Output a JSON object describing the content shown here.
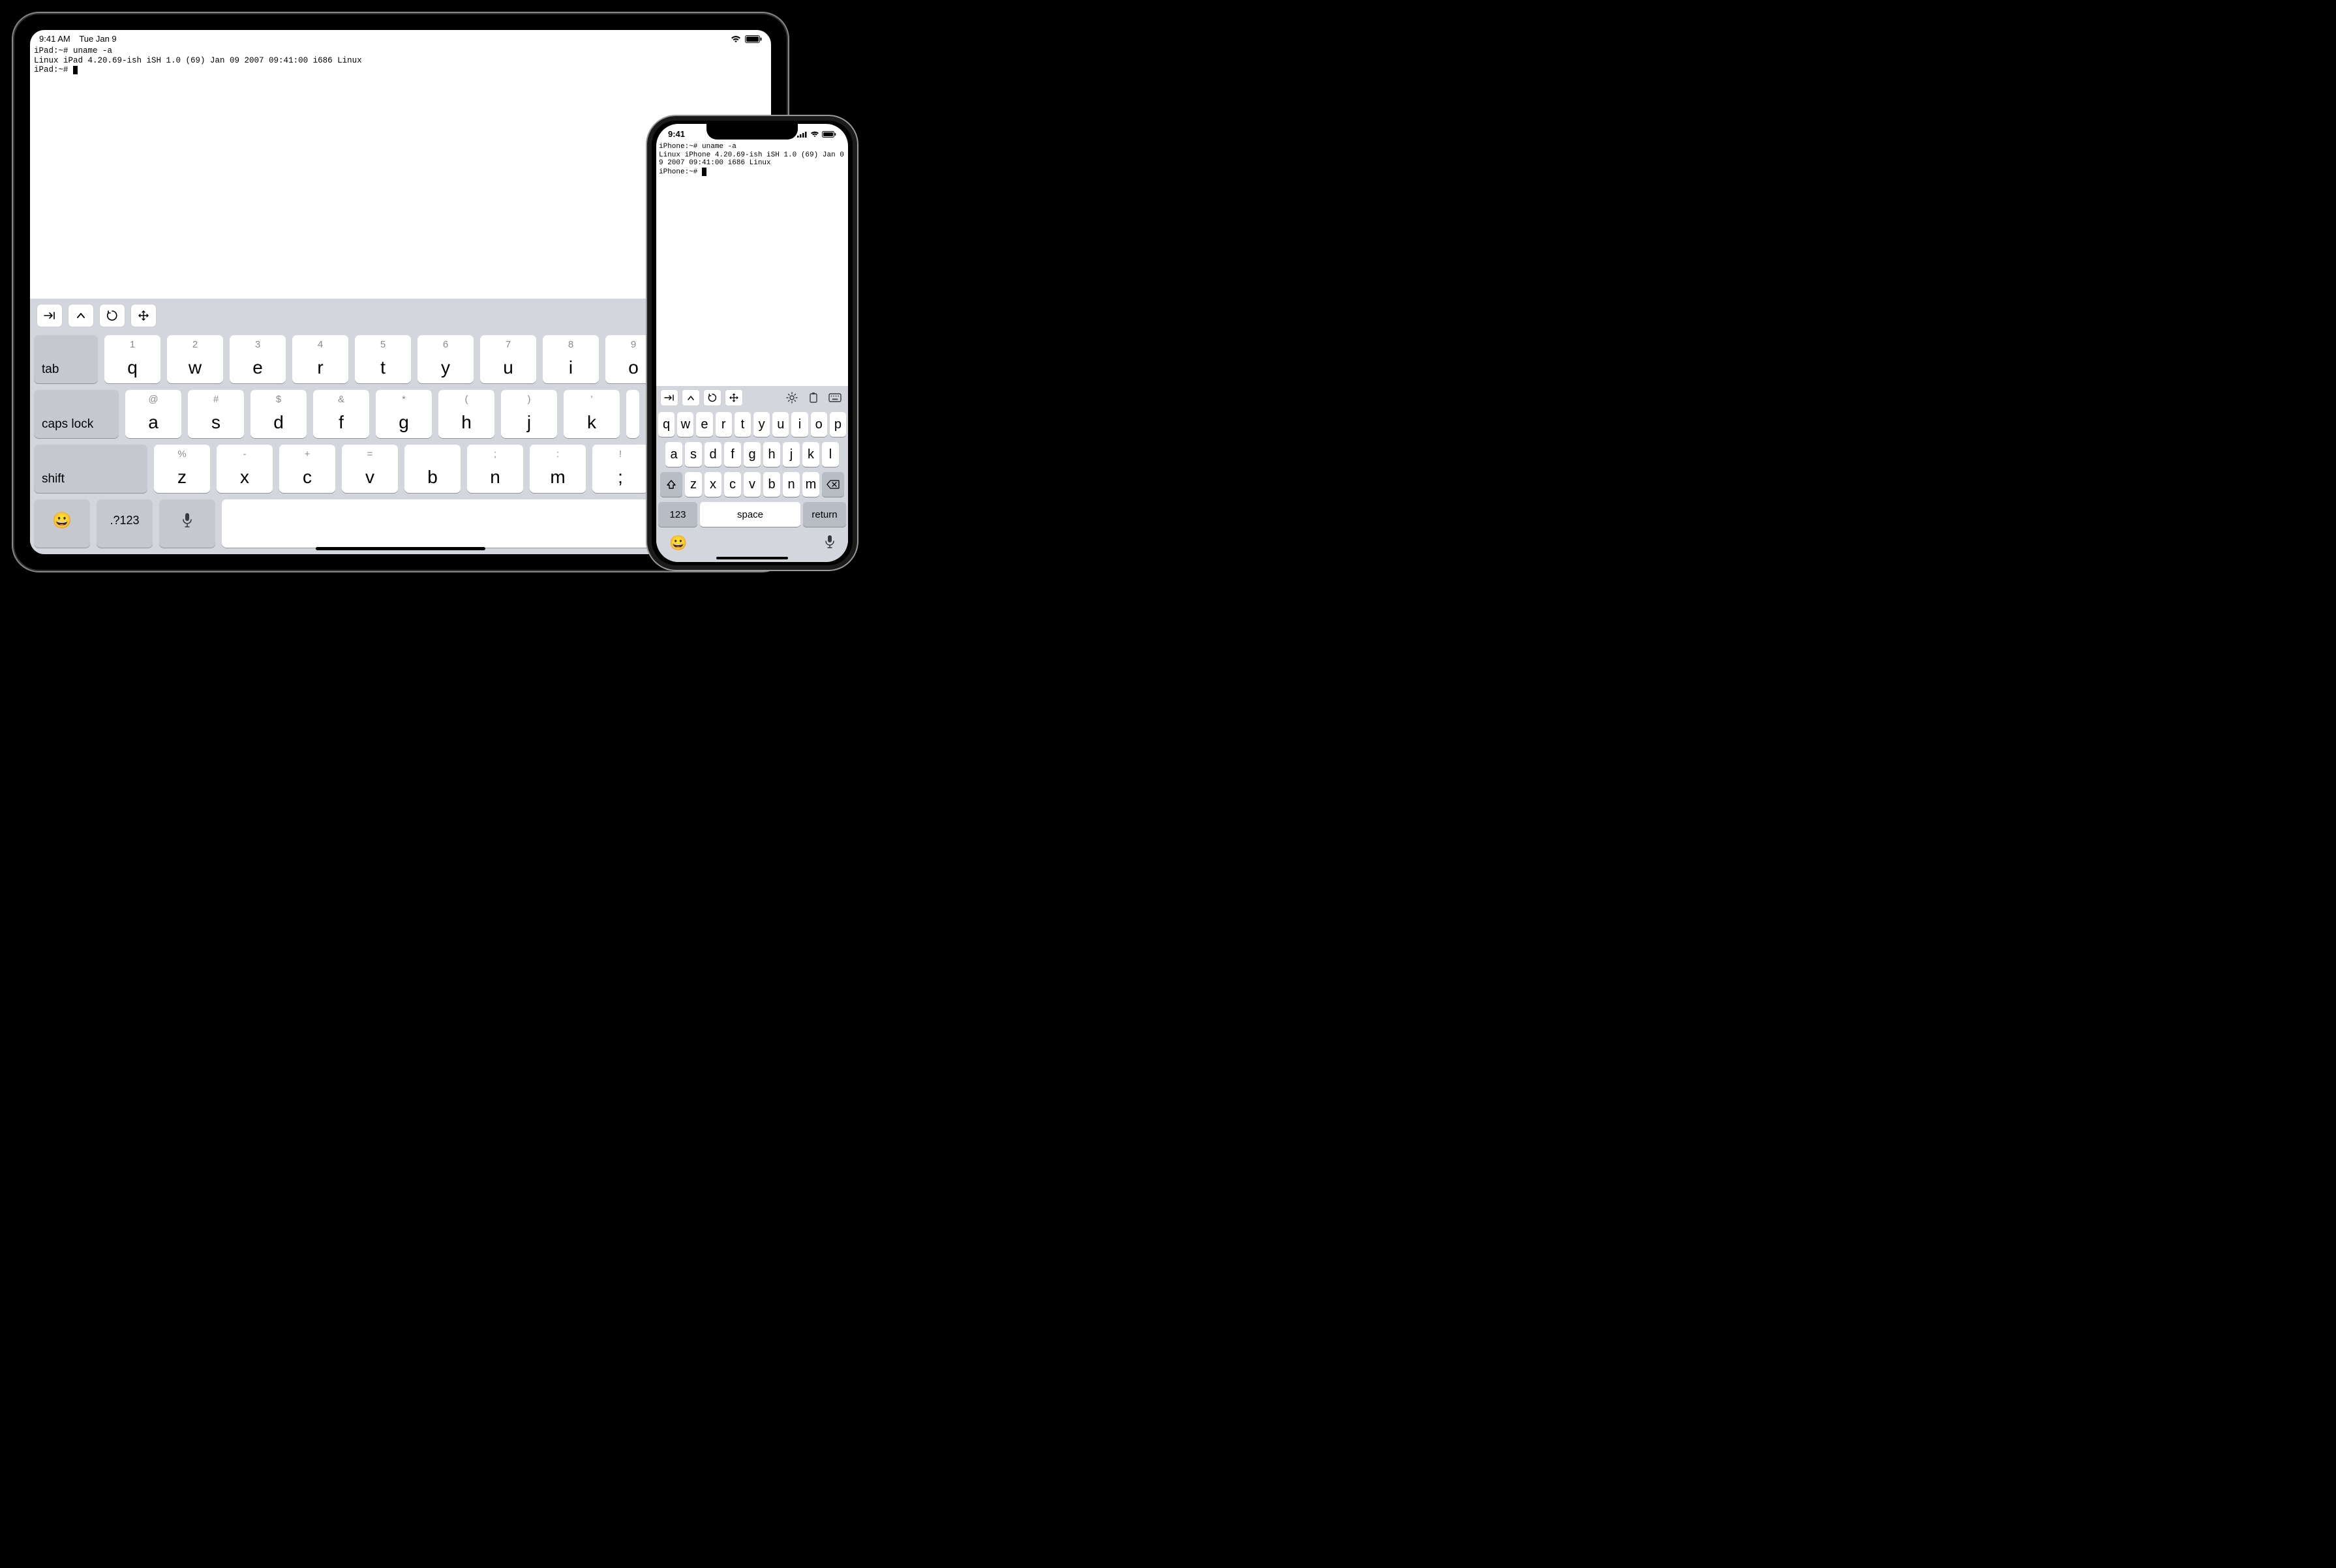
{
  "ipad": {
    "status": {
      "time": "9:41 AM",
      "date": "Tue Jan 9"
    },
    "terminal": {
      "line1": "iPad:~# uname -a",
      "line2": "Linux iPad 4.20.69-ish iSH 1.0 (69) Jan 09 2007 09:41:00 i686 Linux",
      "prompt": "iPad:~# "
    },
    "keys": {
      "row1": [
        {
          "hint": "1",
          "main": "q"
        },
        {
          "hint": "2",
          "main": "w"
        },
        {
          "hint": "3",
          "main": "e"
        },
        {
          "hint": "4",
          "main": "r"
        },
        {
          "hint": "5",
          "main": "t"
        },
        {
          "hint": "6",
          "main": "y"
        },
        {
          "hint": "7",
          "main": "u"
        },
        {
          "hint": "8",
          "main": "i"
        },
        {
          "hint": "9",
          "main": "o"
        }
      ],
      "row2": [
        {
          "hint": "@",
          "main": "a"
        },
        {
          "hint": "#",
          "main": "s"
        },
        {
          "hint": "$",
          "main": "d"
        },
        {
          "hint": "&",
          "main": "f"
        },
        {
          "hint": "*",
          "main": "g"
        },
        {
          "hint": "(",
          "main": "h"
        },
        {
          "hint": ")",
          "main": "j"
        },
        {
          "hint": "'",
          "main": "k"
        }
      ],
      "row3": [
        {
          "hint": "%",
          "main": "z"
        },
        {
          "hint": "-",
          "main": "x"
        },
        {
          "hint": "+",
          "main": "c"
        },
        {
          "hint": "=",
          "main": "v"
        },
        {
          "hint": "",
          "main": "b"
        },
        {
          "hint": ";",
          "main": "n"
        },
        {
          "hint": ":",
          "main": "m"
        },
        {
          "hint": "!",
          "main": ";"
        }
      ],
      "tab": "tab",
      "caps": "caps lock",
      "shift": "shift",
      "numsym": ".?123"
    }
  },
  "iphone": {
    "status": {
      "time": "9:41"
    },
    "terminal": {
      "line1": "iPhone:~# uname -a",
      "line2": "Linux iPhone 4.20.69-ish iSH 1.0 (69) Jan 09 2007 09:41:00 i686 Linux",
      "prompt": "iPhone:~# "
    },
    "keys": {
      "row1": [
        "q",
        "w",
        "e",
        "r",
        "t",
        "y",
        "u",
        "i",
        "o",
        "p"
      ],
      "row2": [
        "a",
        "s",
        "d",
        "f",
        "g",
        "h",
        "j",
        "k",
        "l"
      ],
      "row3": [
        "z",
        "x",
        "c",
        "v",
        "b",
        "n",
        "m"
      ],
      "num": "123",
      "space": "space",
      "ret": "return"
    }
  }
}
